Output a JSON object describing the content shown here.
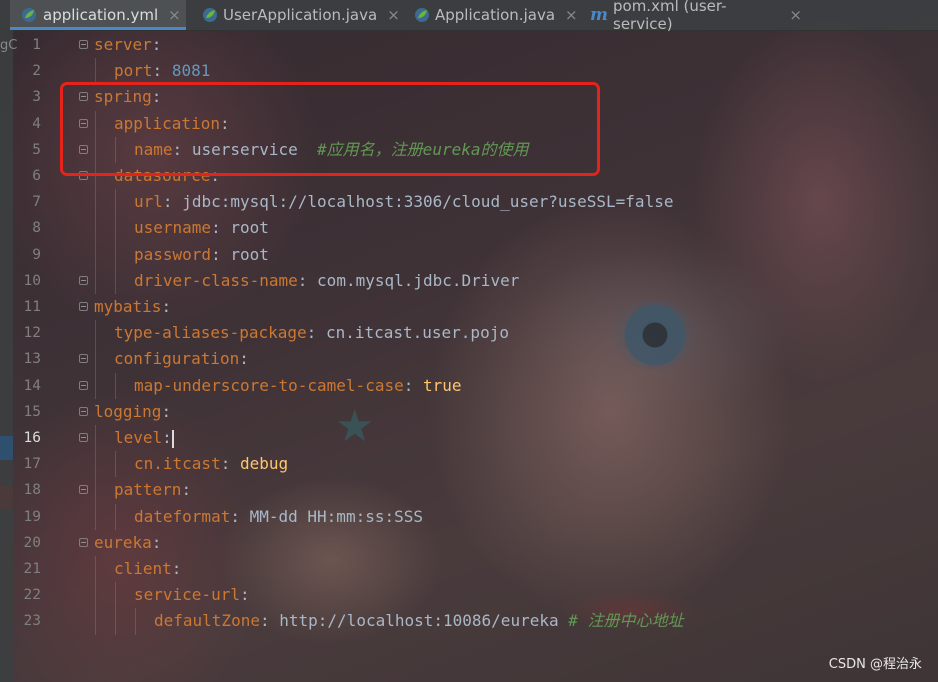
{
  "tabs": [
    {
      "label": "application.yml",
      "icon": "spring-leaf-icon",
      "active": true,
      "close": "×"
    },
    {
      "label": "UserApplication.java",
      "icon": "spring-class-icon",
      "active": false,
      "close": "×"
    },
    {
      "label": "Application.java",
      "icon": "spring-class-icon",
      "active": false,
      "close": "×"
    },
    {
      "label": "pom.xml (user-service)",
      "icon": "maven-m-icon",
      "icon_glyph": "m",
      "active": false,
      "close": "×"
    }
  ],
  "left_panel_partial_text": "gC",
  "editor": {
    "current_line": 16,
    "line_numbers": [
      "1",
      "2",
      "3",
      "4",
      "5",
      "6",
      "7",
      "8",
      "9",
      "10",
      "11",
      "12",
      "13",
      "14",
      "15",
      "16",
      "17",
      "18",
      "19",
      "20",
      "21",
      "22",
      "23"
    ],
    "lines": [
      {
        "indent": 0,
        "key": "server",
        "sep": ":",
        "value": "",
        "value_type": "",
        "comment": ""
      },
      {
        "indent": 1,
        "key": "port",
        "sep": ":",
        "value": "8081",
        "value_type": "number",
        "comment": ""
      },
      {
        "indent": 0,
        "key": "spring",
        "sep": ":",
        "value": "",
        "value_type": "",
        "comment": ""
      },
      {
        "indent": 1,
        "key": "application",
        "sep": ":",
        "value": "",
        "value_type": "",
        "comment": ""
      },
      {
        "indent": 2,
        "key": "name",
        "sep": ":",
        "value": "userservice",
        "value_type": "text",
        "comment": "#应用名，注册eureka的使用"
      },
      {
        "indent": 1,
        "key": "datasource",
        "sep": ":",
        "value": "",
        "value_type": "",
        "comment": ""
      },
      {
        "indent": 2,
        "key": "url",
        "sep": ":",
        "value": "jdbc:mysql://localhost:3306/cloud_user?useSSL=false",
        "value_type": "text",
        "comment": ""
      },
      {
        "indent": 2,
        "key": "username",
        "sep": ":",
        "value": "root",
        "value_type": "text",
        "comment": ""
      },
      {
        "indent": 2,
        "key": "password",
        "sep": ":",
        "value": "root",
        "value_type": "text",
        "comment": ""
      },
      {
        "indent": 2,
        "key": "driver-class-name",
        "sep": ":",
        "value": "com.mysql.jdbc.Driver",
        "value_type": "text",
        "comment": ""
      },
      {
        "indent": 0,
        "key": "mybatis",
        "sep": ":",
        "value": "",
        "value_type": "",
        "comment": ""
      },
      {
        "indent": 1,
        "key": "type-aliases-package",
        "sep": ":",
        "value": "cn.itcast.user.pojo",
        "value_type": "text",
        "comment": ""
      },
      {
        "indent": 1,
        "key": "configuration",
        "sep": ":",
        "value": "",
        "value_type": "",
        "comment": ""
      },
      {
        "indent": 2,
        "key": "map-underscore-to-camel-case",
        "sep": ":",
        "value": "true",
        "value_type": "keyword",
        "comment": ""
      },
      {
        "indent": 0,
        "key": "logging",
        "sep": ":",
        "value": "",
        "value_type": "",
        "comment": ""
      },
      {
        "indent": 1,
        "key": "level",
        "sep": ":",
        "value": "",
        "value_type": "",
        "comment": ""
      },
      {
        "indent": 2,
        "key": "cn.itcast",
        "sep": ":",
        "value": "debug",
        "value_type": "keyword",
        "comment": ""
      },
      {
        "indent": 1,
        "key": "pattern",
        "sep": ":",
        "value": "",
        "value_type": "",
        "comment": ""
      },
      {
        "indent": 2,
        "key": "dateformat",
        "sep": ":",
        "value": "MM-dd HH:mm:ss:SSS",
        "value_type": "text",
        "comment": ""
      },
      {
        "indent": 0,
        "key": "eureka",
        "sep": ":",
        "value": "",
        "value_type": "",
        "comment": ""
      },
      {
        "indent": 1,
        "key": "client",
        "sep": ":",
        "value": "",
        "value_type": "",
        "comment": ""
      },
      {
        "indent": 2,
        "key": "service-url",
        "sep": ":",
        "value": "",
        "value_type": "",
        "comment": ""
      },
      {
        "indent": 3,
        "key": "defaultZone",
        "sep": ":",
        "value": "http://localhost:10086/eureka",
        "value_type": "text",
        "comment": "# 注册中心地址"
      }
    ]
  },
  "colors": {
    "key": "#cc7832",
    "number": "#6897bb",
    "comment": "#629755",
    "keyword_value": "#ffc66d",
    "text": "#a9b7c6",
    "highlight_box": "#e5231b",
    "tab_underline": "#4a88c7"
  },
  "watermark": "CSDN @程治永"
}
